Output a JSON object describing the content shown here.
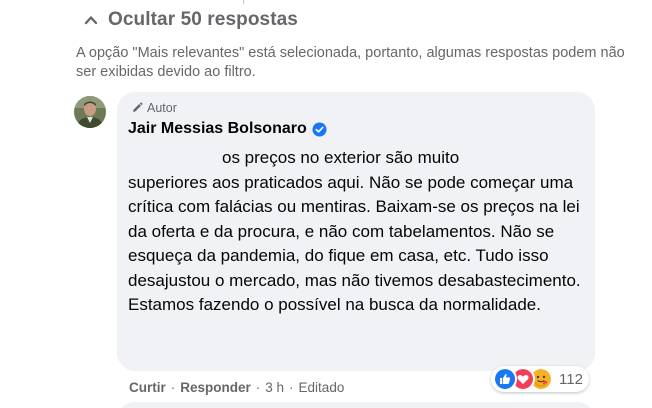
{
  "replies_toggle": {
    "label": "Ocultar 50 respostas",
    "icon": "chevron-up-icon"
  },
  "filter_note": "A opção \"Mais relevantes\" está selecionada, portanto, algumas respostas podem não ser exibidas devido ao filtro.",
  "comment": {
    "author_tag": "Autor",
    "author_name": "Jair Messias Bolsonaro",
    "verified": true,
    "text_first_line": "os preços no exterior são muito",
    "text_rest": "superiores aos praticados aqui. Não se pode começar uma crítica com falácias ou mentiras. Baixam-se os preços na lei da oferta e da procura, e não com tabelamentos. Não se esqueça da pandemia, do fique em casa, etc. Tudo isso desajustou o mercado, mas não tivemos desabastecimento. Estamos fazendo o possível na busca da normalidade."
  },
  "actions": {
    "like": "Curtir",
    "reply": "Responder",
    "time": "3 h",
    "edited": "Editado",
    "separator": "·"
  },
  "reactions": {
    "count": "112",
    "types": [
      "like",
      "love",
      "care"
    ]
  },
  "colors": {
    "secondary_text": "#65676b",
    "bubble_bg": "#f0f2f5",
    "facebook_blue": "#1877f2",
    "love_red": "#f33e58",
    "care_yellow": "#f7b125"
  }
}
